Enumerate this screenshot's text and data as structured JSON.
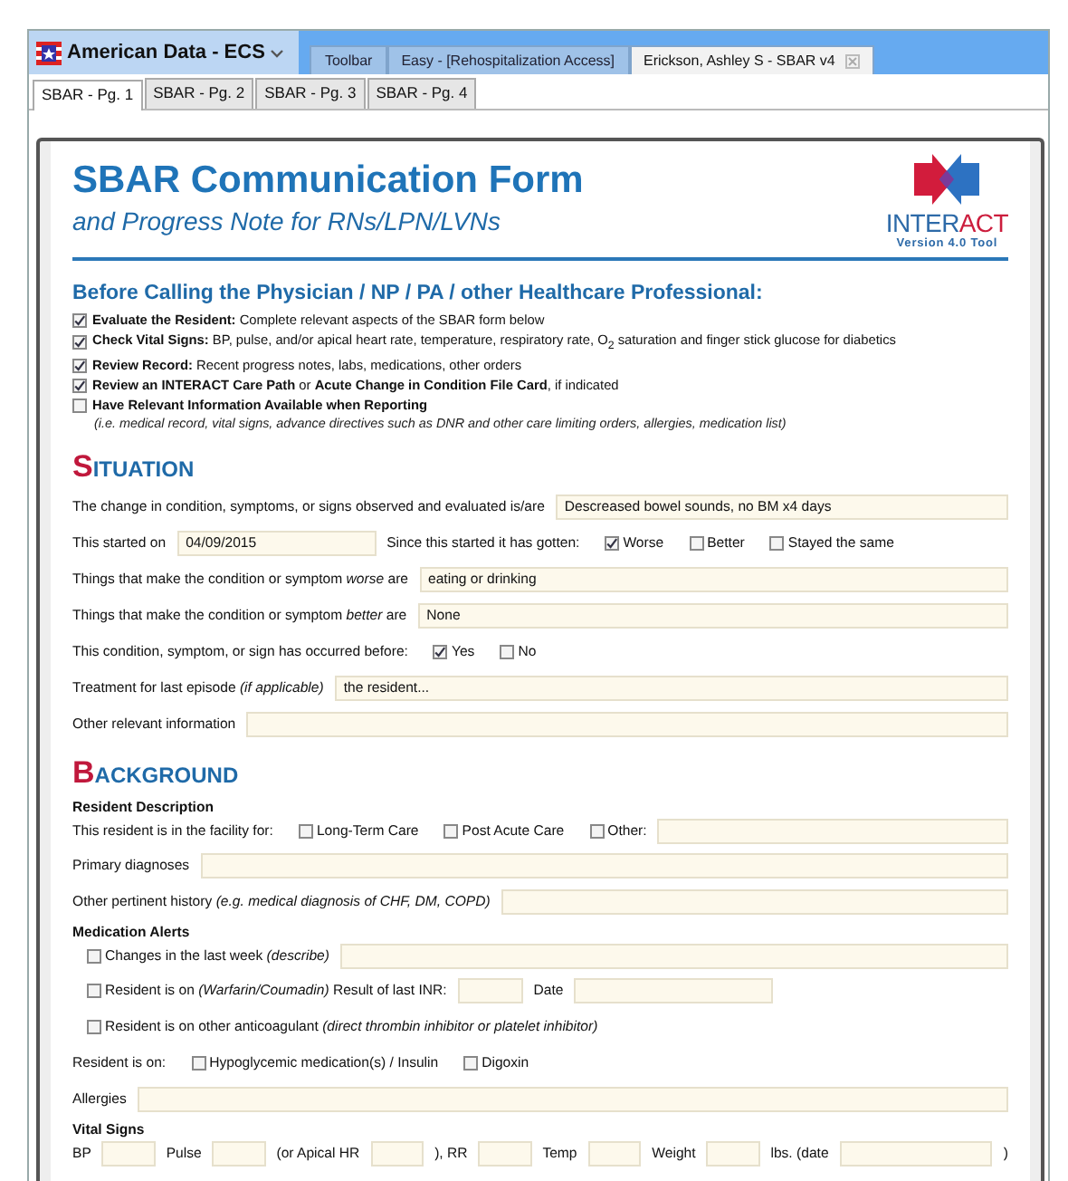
{
  "app": {
    "title": "American Data - ECS",
    "tabs": [
      {
        "label": "Toolbar",
        "selected": false,
        "closable": false
      },
      {
        "label": "Easy - [Rehospitalization Access]",
        "selected": false,
        "closable": false
      },
      {
        "label": "Erickson, Ashley S - SBAR v4",
        "selected": true,
        "closable": true
      }
    ]
  },
  "page_tabs": [
    {
      "label": "SBAR - Pg. 1",
      "selected": true
    },
    {
      "label": "SBAR - Pg. 2",
      "selected": false
    },
    {
      "label": "SBAR - Pg. 3",
      "selected": false
    },
    {
      "label": "SBAR - Pg. 4",
      "selected": false
    }
  ],
  "form": {
    "title": "SBAR Communication Form",
    "subtitle": "and Progress Note for RNs/LPN/LVNs",
    "logo": {
      "text_1": "INTER",
      "text_2": "ACT",
      "version": "Version 4.0 Tool"
    },
    "before_calling": {
      "heading": "Before Calling the Physician / NP / PA / other Healthcare Professional:",
      "items": [
        {
          "text": "**Evaluate the Resident:** Complete relevant aspects of the SBAR form below",
          "checked": true
        },
        {
          "text": "**Check Vital Signs:** BP, pulse, and/or apical heart rate, temperature, respiratory rate, O$_{2}$ saturation and finger stick glucose for diabetics",
          "checked": true
        },
        {
          "text": "**Review Record:** Recent progress notes, labs, medications, other orders",
          "checked": true
        },
        {
          "text": "**Review an INTERACT Care Path** or **Acute Change in Condition File Card**, if indicated",
          "checked": true
        },
        {
          "text": "**Have Relevant Information Available when Reporting**",
          "checked": false
        }
      ],
      "note": "(i.e. medical record, vital signs, advance directives such as DNR and other care limiting orders, allergies, medication list)"
    },
    "sections": [
      {
        "heading": "SITUATION",
        "rows": [
          {
            "kind": "row",
            "parts": [
              {
                "kind": "label",
                "text": "The change in condition, symptoms, or signs observed and evaluated is/are"
              },
              {
                "kind": "field",
                "value": "Descreased bowel sounds, no BM x4 days"
              }
            ]
          },
          {
            "kind": "row",
            "parts": [
              {
                "kind": "label",
                "text": "This started on"
              },
              {
                "kind": "medium_field",
                "value": "04/09/2015"
              },
              {
                "kind": "label",
                "text": "Since this started it has gotten:"
              },
              {
                "kind": "check",
                "label": "Worse",
                "checked": true
              },
              {
                "kind": "check",
                "label": "Better",
                "checked": false
              },
              {
                "kind": "check",
                "label": "Stayed the same",
                "checked": false
              }
            ]
          },
          {
            "kind": "row",
            "parts": [
              {
                "kind": "label",
                "text": "Things that make the condition or symptom *worse* are"
              },
              {
                "kind": "field",
                "value": "eating or drinking"
              }
            ]
          },
          {
            "kind": "row",
            "parts": [
              {
                "kind": "label",
                "text": "Things that make the condition or symptom *better* are"
              },
              {
                "kind": "field",
                "value": "None"
              }
            ]
          },
          {
            "kind": "row",
            "parts": [
              {
                "kind": "label",
                "text": "This condition, symptom, or sign has occurred before:"
              },
              {
                "kind": "check",
                "label": "Yes",
                "checked": true
              },
              {
                "kind": "check",
                "label": "No",
                "checked": false
              }
            ]
          },
          {
            "kind": "row",
            "parts": [
              {
                "kind": "label",
                "text": "Treatment for last episode *(if applicable)*"
              },
              {
                "kind": "field",
                "value": "the resident..."
              }
            ]
          },
          {
            "kind": "row",
            "parts": [
              {
                "kind": "label",
                "text": "Other relevant information"
              },
              {
                "kind": "field"
              }
            ]
          }
        ]
      },
      {
        "heading": "BACKGROUND",
        "rows": [
          {
            "kind": "subheading",
            "text": "Resident Description"
          },
          {
            "kind": "tight_row",
            "parts": [
              {
                "kind": "label",
                "text": "This resident is in the facility for:"
              },
              {
                "kind": "check",
                "label": "Long-Term Care",
                "checked": false
              },
              {
                "kind": "check",
                "label": "Post Acute Care",
                "checked": false
              },
              {
                "kind": "check",
                "label": "Other:",
                "checked": false
              },
              {
                "kind": "field"
              }
            ]
          },
          {
            "kind": "row",
            "parts": [
              {
                "kind": "label",
                "text": "Primary diagnoses"
              },
              {
                "kind": "field"
              }
            ]
          },
          {
            "kind": "row",
            "parts": [
              {
                "kind": "label",
                "text": "Other pertinent history *(e.g. medical diagnosis of CHF, DM, COPD)*"
              },
              {
                "kind": "field"
              }
            ]
          },
          {
            "kind": "subheading",
            "text": "Medication Alerts"
          },
          {
            "kind": "tight_row",
            "parts": [
              {
                "kind": "check",
                "label": "Changes in the last week *(describe)*",
                "checked": false
              },
              {
                "kind": "field"
              }
            ]
          },
          {
            "kind": "row",
            "parts": [
              {
                "kind": "check",
                "label": "Resident is on *(Warfarin/Coumadin)* Result of last INR:",
                "checked": false
              },
              {
                "kind": "short_field"
              },
              {
                "kind": "label",
                "text": "Date"
              },
              {
                "kind": "medium_field"
              }
            ]
          },
          {
            "kind": "row",
            "parts": [
              {
                "kind": "check",
                "label": "Resident is on other anticoagulant *(direct thrombin inhibitor or platelet inhibitor)*",
                "checked": false
              }
            ]
          },
          {
            "kind": "row",
            "parts": [
              {
                "kind": "label",
                "text": "Resident is on:"
              },
              {
                "kind": "check",
                "label": "Hypoglycemic medication(s) / Insulin",
                "checked": false
              },
              {
                "kind": "check",
                "label": "Digoxin",
                "checked": false
              }
            ]
          },
          {
            "kind": "row",
            "parts": [
              {
                "kind": "label",
                "text": "Allergies"
              },
              {
                "kind": "field"
              }
            ]
          },
          {
            "kind": "subheading",
            "text": "Vital Signs"
          },
          {
            "kind": "row",
            "parts": [
              {
                "kind": "label",
                "text": "BP"
              },
              {
                "kind": "short_field"
              },
              {
                "kind": "label",
                "text": "Pulse"
              },
              {
                "kind": "short_field"
              },
              {
                "kind": "label",
                "text": "(or Apical HR"
              },
              {
                "kind": "short_field"
              },
              {
                "kind": "label",
                "text": "), RR"
              },
              {
                "kind": "short_field"
              },
              {
                "kind": "label",
                "text": "Temp"
              },
              {
                "kind": "short_field"
              },
              {
                "kind": "label",
                "text": "Weight"
              },
              {
                "kind": "short_field"
              },
              {
                "kind": "label",
                "text": "lbs. (date"
              },
              {
                "kind": "medium_field"
              },
              {
                "kind": "label",
                "text": ")"
              }
            ]
          }
        ]
      }
    ]
  }
}
